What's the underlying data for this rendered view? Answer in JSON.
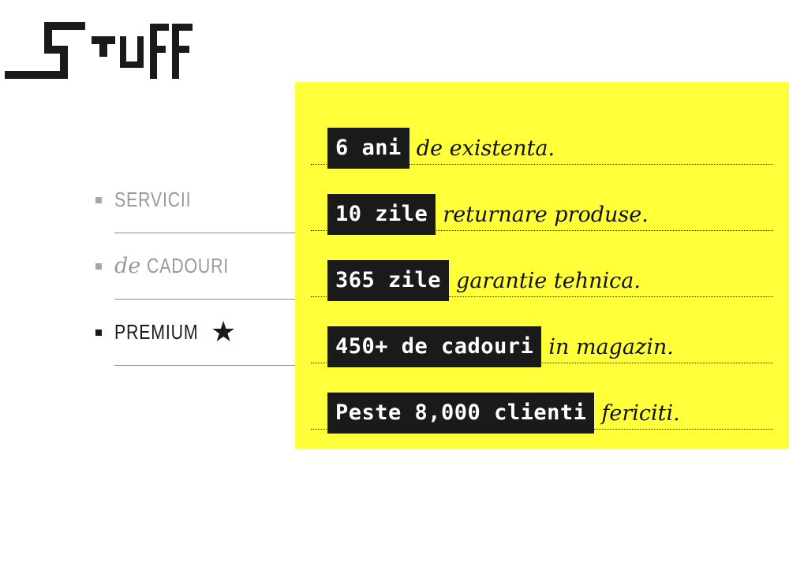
{
  "brand": {
    "logo_text": "STUFF"
  },
  "nav": {
    "items": [
      {
        "label": "SERVICII",
        "prefix": ""
      },
      {
        "label": "CADOURI",
        "prefix": "de"
      },
      {
        "label": "PREMIUM",
        "prefix": "",
        "icon": "star-icon",
        "active": true
      }
    ]
  },
  "stats": [
    {
      "highlight": "6 ani",
      "text": "de existenta."
    },
    {
      "highlight": "10 zile",
      "text": "returnare produse."
    },
    {
      "highlight": "365 zile",
      "text": "garantie tehnica."
    },
    {
      "highlight": "450+ de cadouri",
      "text": "in magazin."
    },
    {
      "highlight": "Peste 8,000 clienti",
      "text": "fericiti."
    }
  ],
  "colors": {
    "panel": "#ffff3a",
    "tag_bg": "#1a1a1a",
    "nav_inactive": "#9a9a9a",
    "nav_active": "#1a1a1a"
  }
}
